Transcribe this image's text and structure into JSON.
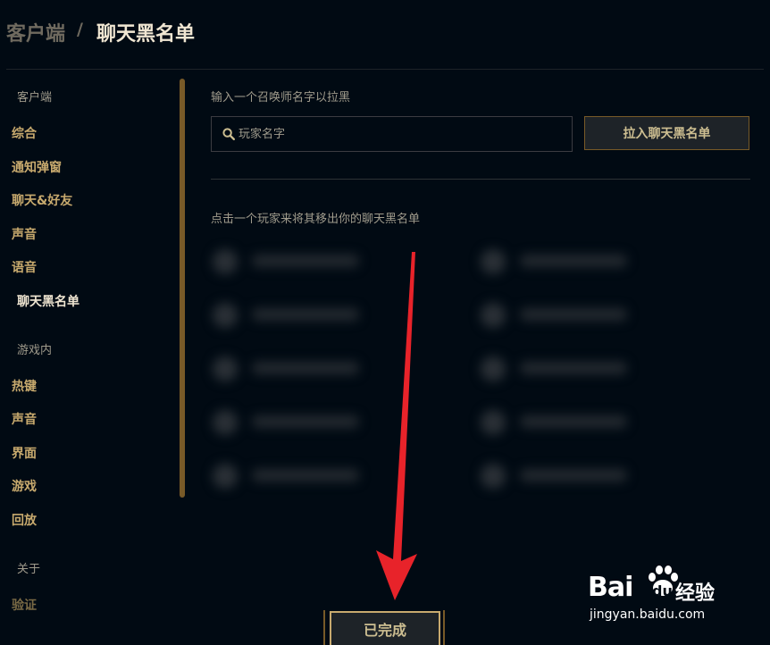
{
  "header": {
    "breadcrumb_root": "客户端",
    "separator": "/",
    "current": "聊天黑名单"
  },
  "sidebar": {
    "sections": [
      {
        "title": "客户端",
        "items": [
          {
            "label": "综合"
          },
          {
            "label": "通知弹窗"
          },
          {
            "label": "聊天&好友"
          },
          {
            "label": "声音"
          },
          {
            "label": "语音"
          },
          {
            "label": "聊天黑名单",
            "active": true
          }
        ]
      },
      {
        "title": "游戏内",
        "items": [
          {
            "label": "热键"
          },
          {
            "label": "声音"
          },
          {
            "label": "界面"
          },
          {
            "label": "游戏"
          },
          {
            "label": "回放"
          }
        ]
      },
      {
        "title": "关于",
        "items": [
          {
            "label": "验证"
          }
        ]
      }
    ]
  },
  "blacklist": {
    "prompt": "输入一个召唤师名字以拉黑",
    "search_placeholder": "玩家名字",
    "add_button": "拉入聊天黑名单",
    "remove_hint": "点击一个玩家来将其移出你的聊天黑名单"
  },
  "footer": {
    "done_button": "已完成"
  },
  "watermark": {
    "brand_left": "Bai",
    "brand_right": "du",
    "product": "经验",
    "url": "jingyan.baidu.com"
  },
  "colors": {
    "background": "#010a13",
    "gold": "#c8aa6e",
    "gold_dark": "#785a28",
    "arrow": "#e8232a"
  },
  "icons": [
    "search-icon",
    "arrow-annotation",
    "paw-icon"
  ]
}
